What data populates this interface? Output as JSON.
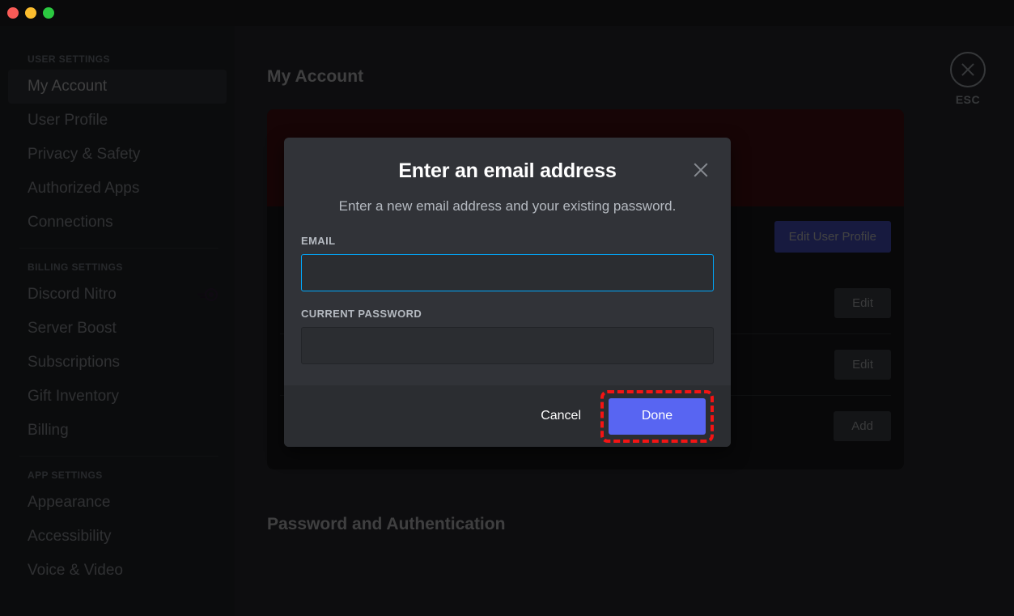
{
  "window": {
    "traffic_lights": [
      "close",
      "minimize",
      "maximize"
    ],
    "colors": {
      "close": "#f95b57",
      "minimize": "#fbbd2e",
      "maximize": "#2bc940"
    }
  },
  "sidebar": {
    "groups": [
      {
        "header": "USER SETTINGS",
        "items": [
          {
            "label": "My Account",
            "active": true,
            "badge": null
          },
          {
            "label": "User Profile",
            "active": false,
            "badge": null
          },
          {
            "label": "Privacy & Safety",
            "active": false,
            "badge": null
          },
          {
            "label": "Authorized Apps",
            "active": false,
            "badge": null
          },
          {
            "label": "Connections",
            "active": false,
            "badge": null
          }
        ]
      },
      {
        "header": "BILLING SETTINGS",
        "items": [
          {
            "label": "Discord Nitro",
            "active": false,
            "badge": "nitro-icon"
          },
          {
            "label": "Server Boost",
            "active": false,
            "badge": null
          },
          {
            "label": "Subscriptions",
            "active": false,
            "badge": null
          },
          {
            "label": "Gift Inventory",
            "active": false,
            "badge": null
          },
          {
            "label": "Billing",
            "active": false,
            "badge": null
          }
        ]
      },
      {
        "header": "APP SETTINGS",
        "items": [
          {
            "label": "Appearance",
            "active": false,
            "badge": null
          },
          {
            "label": "Accessibility",
            "active": false,
            "badge": null
          },
          {
            "label": "Voice & Video",
            "active": false,
            "badge": null
          }
        ]
      }
    ]
  },
  "main": {
    "page_title": "My Account",
    "edit_user_profile_label": "Edit User Profile",
    "rows": [
      {
        "action_label": "Edit"
      },
      {
        "action_label": "Edit"
      },
      {
        "action_label": "Add"
      }
    ],
    "section_title": "Password and Authentication",
    "close": {
      "icon": "close-icon",
      "label": "ESC"
    }
  },
  "modal": {
    "title": "Enter an email address",
    "subtitle": "Enter a new email address and your existing password.",
    "close_icon": "close-icon",
    "fields": [
      {
        "label": "EMAIL",
        "value": "",
        "placeholder": "",
        "focused": true
      },
      {
        "label": "CURRENT PASSWORD",
        "value": "",
        "placeholder": "",
        "focused": false
      }
    ],
    "cancel_label": "Cancel",
    "done_label": "Done"
  },
  "annotation": {
    "highlight_target": "Done",
    "highlight_color": "#f41414",
    "highlight_style": "dashed"
  },
  "theme": {
    "accent": "#5865f2",
    "focus_border": "#00a8fc",
    "banner": "#5a1417",
    "surface": "#313338",
    "surface_alt": "#2b2d31",
    "surface_dark": "#1e1f22"
  }
}
